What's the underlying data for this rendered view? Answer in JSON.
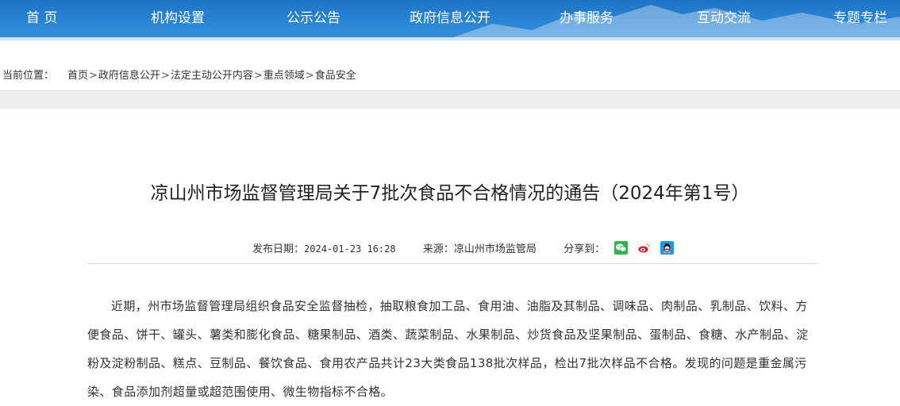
{
  "nav": {
    "items": [
      "首 页",
      "机构设置",
      "公示公告",
      "政府信息公开",
      "办事服务",
      "互动交流",
      "专题专栏"
    ],
    "color": "#2a86d6"
  },
  "breadcrumb": {
    "label": "当前位置：",
    "items": [
      "首页",
      "政府信息公开",
      "法定主动公开内容",
      "重点领域",
      "食品安全"
    ],
    "separator": ">"
  },
  "article": {
    "title": "凉山州市场监督管理局关于7批次食品不合格情况的通告（2024年第1号）",
    "publish_label": "发布日期：",
    "publish_date": "2024-01-23 16:28",
    "source_label": "来源：",
    "source": "凉山州市场监管局",
    "share_label": "分享到：",
    "share_icons": [
      "wechat-icon",
      "weibo-icon",
      "qq-icon"
    ],
    "body": "近期，州市场监督管理局组织食品安全监督抽检，抽取粮食加工品、食用油、油脂及其制品、调味品、肉制品、乳制品、饮料、方便食品、饼干、罐头、薯类和膨化食品、糖果制品、酒类、蔬菜制品、水果制品、炒货食品及坚果制品、蛋制品、食糖、水产制品、淀粉及淀粉制品、糕点、豆制品、餐饮食品、食用农产品共计23大类食品138批次样品，检出7批次样品不合格。发现的问题是重金属污染、食品添加剂超量或超范围使用、微生物指标不合格。"
  }
}
